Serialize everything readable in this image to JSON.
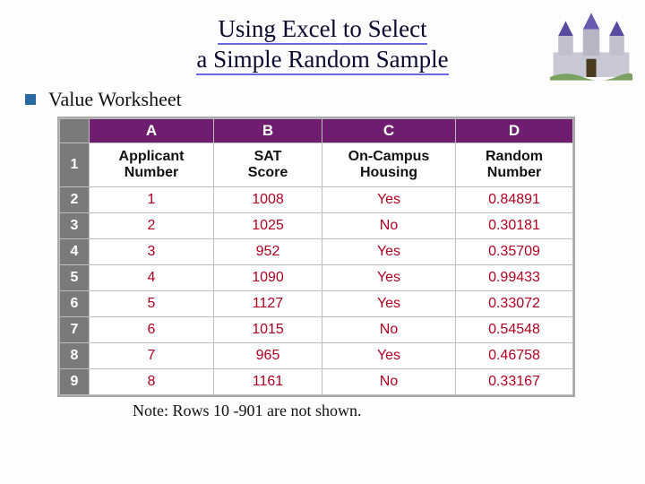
{
  "title_line1": "Using Excel to Select",
  "title_line2": "a Simple Random Sample",
  "bullet_label": "Value Worksheet",
  "note": "Note:  Rows 10 -901 are not shown.",
  "col_letters": [
    "A",
    "B",
    "C",
    "D"
  ],
  "field_headers": {
    "A": "Applicant\nNumber",
    "B": "SAT\nScore",
    "C": "On-Campus\nHousing",
    "D": "Random\nNumber"
  },
  "rows": [
    {
      "n": "2",
      "A": "1",
      "B": "1008",
      "C": "Yes",
      "D": "0.84891"
    },
    {
      "n": "3",
      "A": "2",
      "B": "1025",
      "C": "No",
      "D": "0.30181"
    },
    {
      "n": "4",
      "A": "3",
      "B": "952",
      "C": "Yes",
      "D": "0.35709"
    },
    {
      "n": "5",
      "A": "4",
      "B": "1090",
      "C": "Yes",
      "D": "0.99433"
    },
    {
      "n": "6",
      "A": "5",
      "B": "1127",
      "C": "Yes",
      "D": "0.33072"
    },
    {
      "n": "7",
      "A": "6",
      "B": "1015",
      "C": "No",
      "D": "0.54548"
    },
    {
      "n": "8",
      "A": "7",
      "B": "965",
      "C": "Yes",
      "D": "0.46758"
    },
    {
      "n": "9",
      "A": "8",
      "B": "1161",
      "C": "No",
      "D": "0.33167"
    }
  ],
  "header_rownum": "1",
  "castle_alt": "castle clipart"
}
